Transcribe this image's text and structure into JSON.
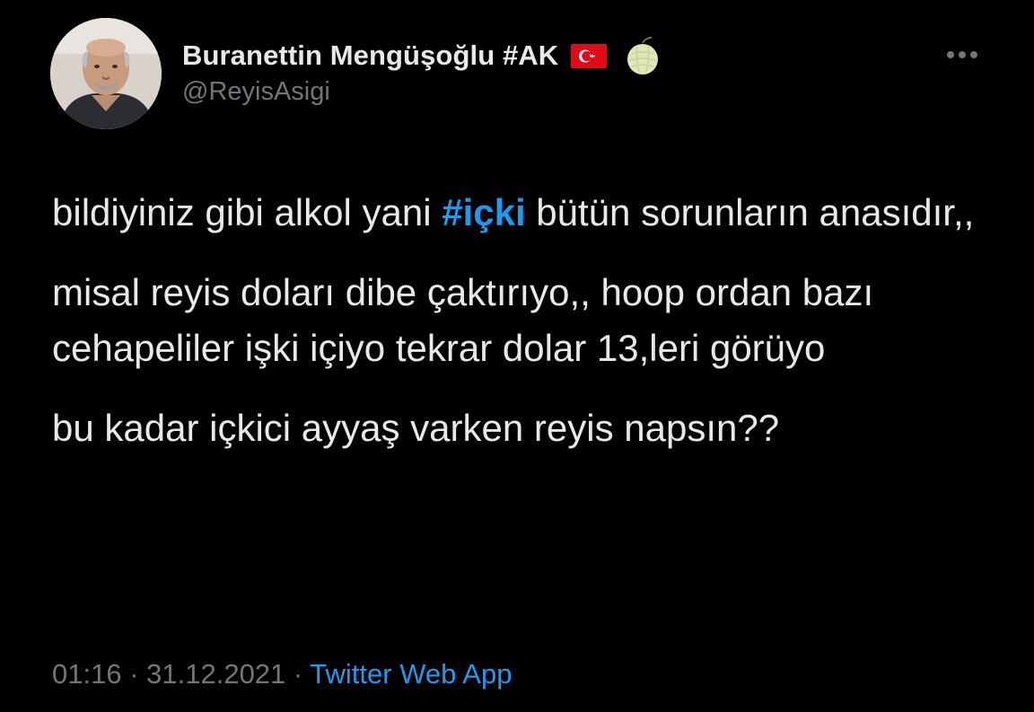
{
  "author": {
    "display_name": "Buranettin Mengüşoğlu #AK",
    "handle": "@ReyisAsigi",
    "badges": [
      "turkey-flag-icon",
      "melon-icon"
    ]
  },
  "menu": {
    "icon": "more-horizontal-icon"
  },
  "tweet": {
    "paragraph_1": {
      "before": "bildiyiniz gibi alkol yani ",
      "hashtag": "#içki",
      "after": " bütün sorunların anasıdır,,"
    },
    "paragraph_2": "misal reyis doları dibe çaktırıyo,, hoop ordan bazı cehapeliler işki içiyo tekrar dolar 13,leri görüyo",
    "paragraph_3": "bu kadar içkici ayyaş varken reyis napsın??"
  },
  "meta": {
    "time": "01:16",
    "separator_1": " · ",
    "date": "31.12.2021",
    "separator_2": " · ",
    "source": "Twitter Web App"
  },
  "colors": {
    "background": "#000000",
    "text": "#e7e9ea",
    "secondary": "#71767b",
    "accent": "#1d9bf0",
    "flag_red": "#e30a17"
  }
}
